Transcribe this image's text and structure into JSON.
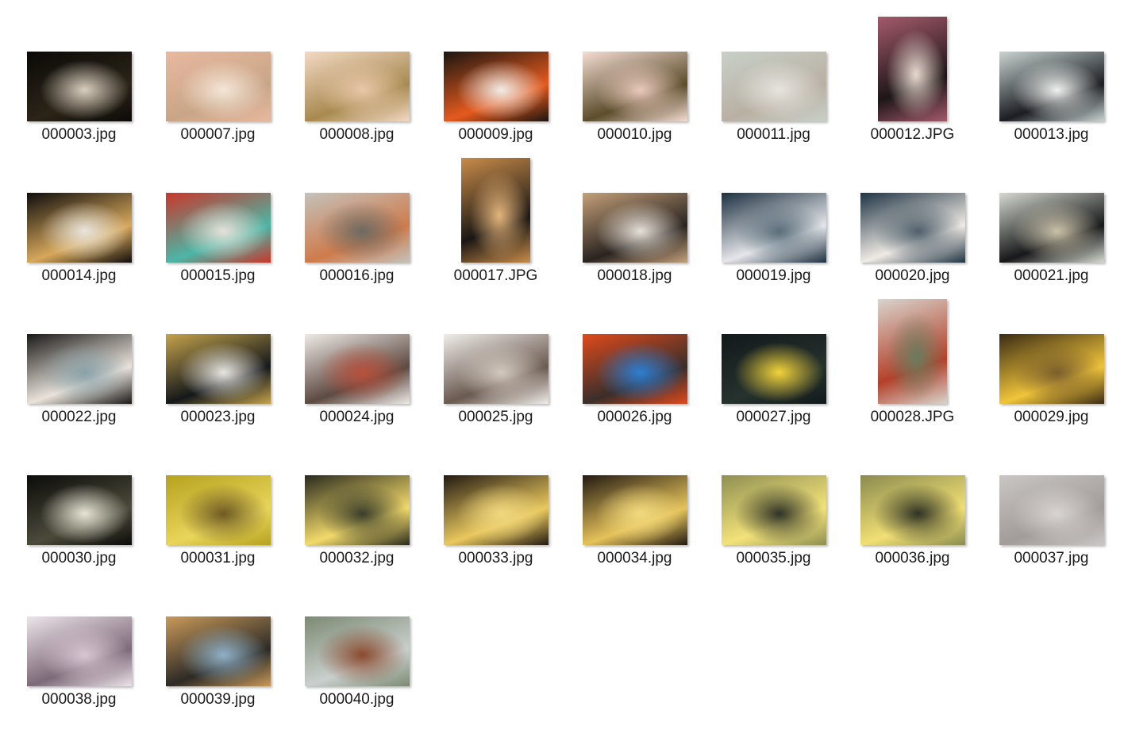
{
  "files": [
    {
      "name": "000003.jpg",
      "orientation": "landscape",
      "thumb_colors": [
        "#0b0a08",
        "#2b2417",
        "#d9cfc0"
      ]
    },
    {
      "name": "000007.jpg",
      "orientation": "landscape",
      "thumb_colors": [
        "#e8b9a0",
        "#c9a587",
        "#f4e6d7"
      ]
    },
    {
      "name": "000008.jpg",
      "orientation": "landscape",
      "thumb_colors": [
        "#f3d9c4",
        "#a88a50",
        "#e7c7a8"
      ]
    },
    {
      "name": "000009.jpg",
      "orientation": "landscape",
      "thumb_colors": [
        "#1b1510",
        "#e55a1e",
        "#f1ece6"
      ]
    },
    {
      "name": "000010.jpg",
      "orientation": "landscape",
      "thumb_colors": [
        "#f4ddd3",
        "#5c4d2c",
        "#e9c9bb"
      ]
    },
    {
      "name": "000011.jpg",
      "orientation": "landscape",
      "thumb_colors": [
        "#c8d0c8",
        "#b9b0a3",
        "#e6e4de"
      ]
    },
    {
      "name": "000012.JPG",
      "orientation": "portrait",
      "thumb_colors": [
        "#a45a6b",
        "#1d1618",
        "#e8d9cf"
      ]
    },
    {
      "name": "000013.jpg",
      "orientation": "landscape",
      "thumb_colors": [
        "#c9d5d2",
        "#1b1d22",
        "#eef1ee"
      ]
    },
    {
      "name": "000014.jpg",
      "orientation": "landscape",
      "thumb_colors": [
        "#0f0d0c",
        "#d7a85b",
        "#e9e4dc"
      ]
    },
    {
      "name": "000015.jpg",
      "orientation": "landscape",
      "thumb_colors": [
        "#c9362a",
        "#4bb6a6",
        "#e4e2da"
      ]
    },
    {
      "name": "000016.jpg",
      "orientation": "landscape",
      "thumb_colors": [
        "#c4c2bb",
        "#cf7b4c",
        "#6d6a62"
      ]
    },
    {
      "name": "000017.JPG",
      "orientation": "portrait",
      "thumb_colors": [
        "#c88c4a",
        "#1b1714",
        "#e3b47b"
      ]
    },
    {
      "name": "000018.jpg",
      "orientation": "landscape",
      "thumb_colors": [
        "#c4a07a",
        "#2a2420",
        "#e6e0d8"
      ]
    },
    {
      "name": "000019.jpg",
      "orientation": "landscape",
      "thumb_colors": [
        "#1d3040",
        "#e4e6ea",
        "#5a6e7a"
      ]
    },
    {
      "name": "000020.jpg",
      "orientation": "landscape",
      "thumb_colors": [
        "#1f3444",
        "#efeae4",
        "#50606c"
      ]
    },
    {
      "name": "000021.jpg",
      "orientation": "landscape",
      "thumb_colors": [
        "#d5d9cf",
        "#17181a",
        "#c9c1a8"
      ]
    },
    {
      "name": "000022.jpg",
      "orientation": "landscape",
      "thumb_colors": [
        "#1b1917",
        "#e9e3db",
        "#8aa1a8"
      ]
    },
    {
      "name": "000023.jpg",
      "orientation": "landscape",
      "thumb_colors": [
        "#c4a34c",
        "#15181b",
        "#e8e6e1"
      ]
    },
    {
      "name": "000024.jpg",
      "orientation": "landscape",
      "thumb_colors": [
        "#eeeae6",
        "#5d4a42",
        "#b8503c"
      ]
    },
    {
      "name": "000025.jpg",
      "orientation": "landscape",
      "thumb_colors": [
        "#f0ede9",
        "#6a5a50",
        "#d2c9bf"
      ]
    },
    {
      "name": "000026.jpg",
      "orientation": "landscape",
      "thumb_colors": [
        "#e04a1c",
        "#3a2e2a",
        "#2d7ed1"
      ]
    },
    {
      "name": "000027.jpg",
      "orientation": "landscape",
      "thumb_colors": [
        "#11191a",
        "#26322e",
        "#f2d33a"
      ]
    },
    {
      "name": "000028.JPG",
      "orientation": "portrait",
      "thumb_colors": [
        "#d9d4cc",
        "#b3402a",
        "#6a7c5e"
      ]
    },
    {
      "name": "000029.jpg",
      "orientation": "landscape",
      "thumb_colors": [
        "#3b2c14",
        "#f0c43a",
        "#7a5e2c"
      ]
    },
    {
      "name": "000030.jpg",
      "orientation": "landscape",
      "thumb_colors": [
        "#0b0b09",
        "#4b4a3a",
        "#e7e4d4"
      ]
    },
    {
      "name": "000031.jpg",
      "orientation": "landscape",
      "thumb_colors": [
        "#b6a21e",
        "#e8d55a",
        "#6e5a22"
      ]
    },
    {
      "name": "000032.jpg",
      "orientation": "landscape",
      "thumb_colors": [
        "#2a2a1e",
        "#f2da6a",
        "#3a3d2b"
      ]
    },
    {
      "name": "000033.jpg",
      "orientation": "landscape",
      "thumb_colors": [
        "#231a12",
        "#e9c85e",
        "#f0d77f"
      ]
    },
    {
      "name": "000034.jpg",
      "orientation": "landscape",
      "thumb_colors": [
        "#231a12",
        "#e5c25a",
        "#f1d97e"
      ]
    },
    {
      "name": "000035.jpg",
      "orientation": "landscape",
      "thumb_colors": [
        "#8e8f52",
        "#f3e27a",
        "#2f3326"
      ]
    },
    {
      "name": "000036.jpg",
      "orientation": "landscape",
      "thumb_colors": [
        "#8a8b4f",
        "#f1df74",
        "#2e3224"
      ]
    },
    {
      "name": "000037.jpg",
      "orientation": "landscape",
      "thumb_colors": [
        "#c9c6c4",
        "#a29c9a",
        "#d8d4d2"
      ]
    },
    {
      "name": "000038.jpg",
      "orientation": "landscape",
      "thumb_colors": [
        "#ede4ea",
        "#7d6a78",
        "#d9c6d3"
      ]
    },
    {
      "name": "000039.jpg",
      "orientation": "landscape",
      "thumb_colors": [
        "#c99a5a",
        "#2d2a26",
        "#8eb0c7"
      ]
    },
    {
      "name": "000040.jpg",
      "orientation": "landscape",
      "thumb_colors": [
        "#7c8a72",
        "#c9cfcd",
        "#8a4a2e"
      ]
    }
  ]
}
